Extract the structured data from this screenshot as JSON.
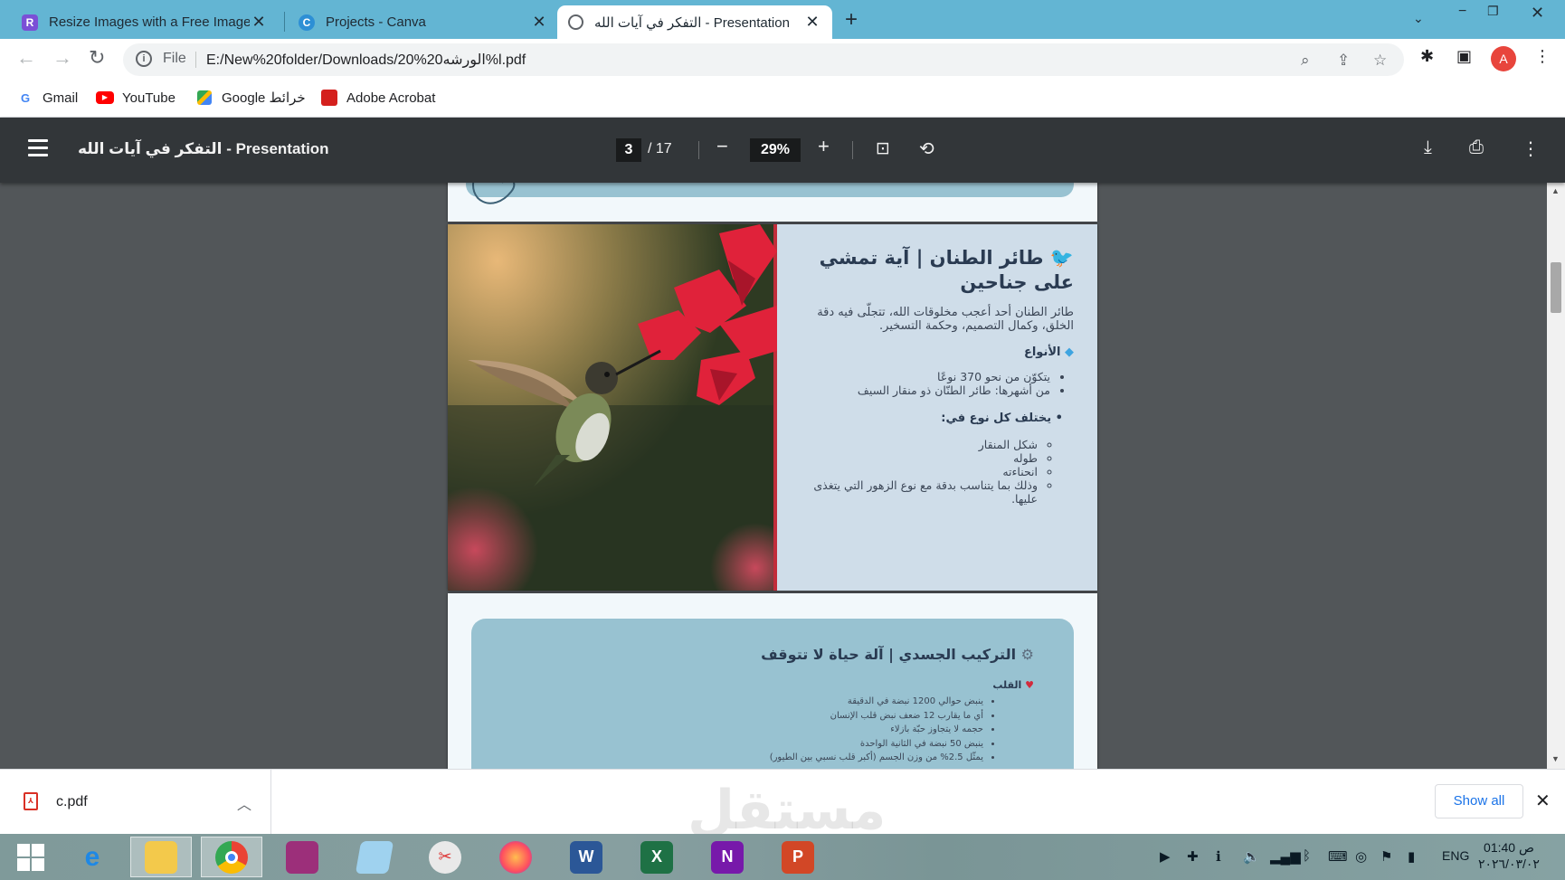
{
  "browser": {
    "tabs": [
      {
        "title": "Resize Images with a Free Image",
        "favicon": "R",
        "favicon_color": "#7b4fd6"
      },
      {
        "title": "Projects - Canva",
        "favicon": "C",
        "favicon_color": "#2d8fd5"
      },
      {
        "title": "التفكر في آيات الله - Presentation",
        "favicon": "globe-icon",
        "active": true
      }
    ],
    "url_scheme": "File",
    "url": "E:/New%20folder/Downloads/20%20الورشه%l.pdf",
    "profile_initial": "A",
    "bookmarks": [
      {
        "label": "Gmail",
        "icon": "G"
      },
      {
        "label": "YouTube",
        "icon": "youtube-icon"
      },
      {
        "label": "Google خرائط",
        "icon": "maps-icon"
      },
      {
        "label": "Adobe Acrobat",
        "icon": "acrobat-icon"
      }
    ]
  },
  "pdf": {
    "title": "التفكر في آيات الله - Presentation",
    "current_page": "3",
    "total_pages": "/ 17",
    "zoom": "29%"
  },
  "slide": {
    "title_line1": "طائر الطنان | آية تمشي",
    "title_line2": "على جناحين",
    "intro": "طائر الطنان أحد أعجب مخلوقات الله، تتجلّى فيه دقة الخلق، وكمال التصميم، وحكمة التسخير.",
    "types_heading": "الأنواع",
    "types_items": [
      "يتكوّن من نحو 370 نوعًا",
      "من أشهرها: طائر الطنّان ذو منقار السيف"
    ],
    "differs_heading": "يختلف كل نوع في:",
    "differs_items": [
      "شكل المنقار",
      "طوله",
      "انحناءته",
      "وذلك بما يتناسب بدقة مع نوع الزهور التي يتغذى عليها."
    ]
  },
  "next_slide": {
    "title": "التركيب الجسدي | آلة حياة لا تتوقف",
    "heart_heading": "القلب",
    "items": [
      "ينبض حوالي 1200 نبضة في الدقيقة",
      "أي ما يقارب 12 ضعف نبض قلب الإنسان",
      "حجمه لا يتجاوز حبّة بازلاء",
      "ينبض 50 نبضة في الثانية الواحدة",
      "يمثّل 2.5% من وزن الجسم (أكبر قلب نسبي بين الطيور)"
    ]
  },
  "downloads": {
    "file_name": "c.pdf",
    "show_all": "Show all",
    "watermark": "مستقل"
  },
  "taskbar": {
    "language": "ENG",
    "time": "01:40 ص",
    "date": "٢٠٢٦/٠٣/٠٢",
    "apps": [
      "start",
      "internet-explorer",
      "file-explorer",
      "chrome",
      "winrar",
      "notepad",
      "snipping-tool",
      "firefox",
      "word",
      "excel",
      "onenote",
      "powerpoint"
    ]
  }
}
